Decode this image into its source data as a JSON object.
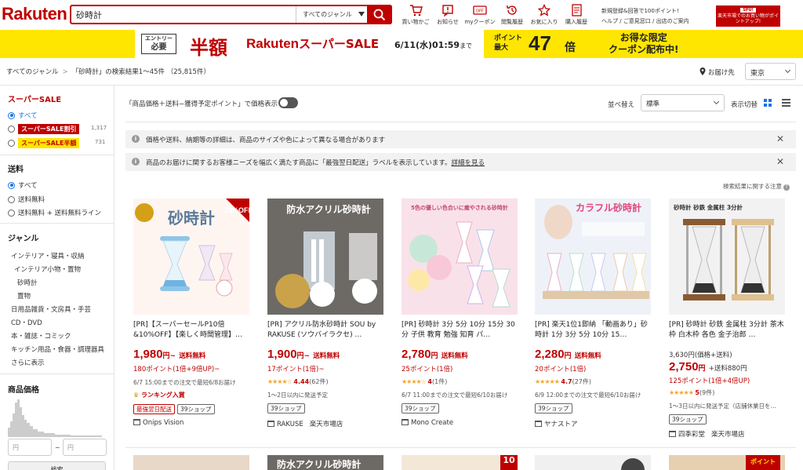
{
  "header": {
    "logo": "Rakuten",
    "search_value": "砂時計",
    "genre_select": "すべてのジャンル",
    "icons": [
      {
        "label": "買い物かご",
        "icon": "cart-icon"
      },
      {
        "label": "お知らせ",
        "icon": "notice-icon"
      },
      {
        "label": "myクーポン",
        "icon": "coupon-icon"
      },
      {
        "label": "閲覧履歴",
        "icon": "history-icon"
      },
      {
        "label": "お気に入り",
        "icon": "star-icon"
      },
      {
        "label": "購入履歴",
        "icon": "receipt-icon"
      }
    ],
    "promo": "新規登録&回答で100ポイント!",
    "help": "ヘルプ / ご意見窓口 / 出店のご案内",
    "spu_top": "SPU!",
    "spu_text": "楽天市場でのお買い物がポイントアップ!"
  },
  "banner": {
    "entry_top": "エントリー",
    "entry_bottom": "必要",
    "hangaku": "半額",
    "brand": "Rakuten",
    "sale": "スーパーSALE",
    "deadline": "6/11(水)01:59",
    "deadline_suffix": "まで",
    "point_label_1": "ポイント",
    "point_label_2": "最大",
    "point_num": "47",
    "point_unit": "倍",
    "coupon_1": "お得な限定",
    "coupon_2": "クーポン配布中!"
  },
  "breadcrumb": {
    "root": "すべてのジャンル",
    "sep": ">",
    "result": "「砂時計」の検索結果1〜45件 （25,815件）"
  },
  "delivery": {
    "label": "お届け先",
    "region": "東京"
  },
  "sidebar": {
    "super_sale_title": "スーパーSALE",
    "sale_all": "すべて",
    "sale_discount": "スーパーSALE割引",
    "sale_discount_count": "1,317",
    "sale_half": "スーパーSALE半額",
    "sale_half_count": "731",
    "shipping_title": "送料",
    "ship_all": "すべて",
    "ship_free": "送料無料",
    "ship_free_line": "送料無料 + 送料無料ライン",
    "genre_title": "ジャンル",
    "genres": [
      "インテリア・寝具・収納",
      "インテリア小物・置物",
      "砂時計",
      "置物",
      "日用品雑貨・文房具・手芸",
      "CD・DVD",
      "本・雑誌・コミック",
      "キッチン用品・食器・調理器具",
      "さらに表示"
    ],
    "price_title": "商品価格",
    "price_min_ph": "円",
    "price_tilde": "~",
    "price_max_ph": "円",
    "search_btn": "検索"
  },
  "toolbar": {
    "toggle_text": "「商品価格＋送料−獲得予定ポイント」で価格表示",
    "sort_label": "並べ替え",
    "sort_value": "標準",
    "view_label": "表示切替"
  },
  "notices": [
    "価格や送料、納期等の詳細は、商品のサイズや色によって異なる場合があります",
    "商品のお届けに関するお客様ニーズを幅広く満たす商品に「最強翌日配送」ラベルを表示しています。"
  ],
  "notice_link": "詳細を見る",
  "disclaimer": "検索結果に関する注意",
  "products": [
    {
      "title": "[PR]【スーパーセールP10倍&10%OFF】【楽しく時間管理】…",
      "price": "1,980",
      "price_suffix": "円~",
      "shipping": "送料無料",
      "point": "180ポイント(1倍+9倍UP)~",
      "delivery": "6/7 15:00までの注文で最短6/8お届け",
      "rank": "ランキング入賞",
      "badge_red": "最強翌日配送",
      "badge39": "39ショップ",
      "shop": "Onips Vision",
      "img_label": "砂時計",
      "img_corner": "10%OFF"
    },
    {
      "title": "[PR] アクリル防水砂時計 SOU by RAKUSE (ソウバイラクセ) …",
      "price": "1,900",
      "price_suffix": "円~",
      "shipping": "送料無料",
      "point": "17ポイント(1倍)~",
      "stars": "★★★★☆",
      "rating": "4.44",
      "reviews": "(62件)",
      "delivery": "1〜2日以内に発送予定",
      "badge39": "39ショップ",
      "shop": "RAKUSE",
      "mall": "楽天市場店",
      "img_label": "防水アクリル砂時計"
    },
    {
      "title": "[PR] 砂時計 3分 5分 10分 15分 30分 子供 教育 勉強 知育 パ…",
      "price": "2,780",
      "price_suffix": "円",
      "shipping": "送料無料",
      "point": "25ポイント(1倍)",
      "stars": "★★★★☆",
      "rating": "4",
      "reviews": "(1件)",
      "delivery": "6/7 11:00までの注文で最短6/10お届け",
      "badge39": "39ショップ",
      "shop": "Mono Create",
      "img_label": "5色の優しい色合いに癒やされる砂時計"
    },
    {
      "title": "[PR] 楽天1位1即納 「動画あり」砂時計 1分 3分 5分 10分 15…",
      "price": "2,280",
      "price_suffix": "円",
      "shipping": "送料無料",
      "point": "20ポイント(1倍)",
      "stars": "★★★★★",
      "rating": "4.7",
      "reviews": "(27件)",
      "delivery": "6/9 12:00までの注文で最短6/10お届け",
      "badge39": "39ショップ",
      "shop": "ヤナストア",
      "img_label": "カラフル砂時計"
    },
    {
      "title": "[PR] 砂時計 砂鉄 金属柱 3分計 茶木枠 白木枠 各色 金子治郎 …",
      "base_price": "3,630円(価格+送料)",
      "price": "2,750",
      "price_suffix": "円",
      "extra": "+送料880円",
      "point": "125ポイント(1倍+4倍UP)",
      "stars": "★★★★★",
      "rating": "5",
      "reviews": "(9件)",
      "delivery": "1〜3日以内に発送予定（店舗休業日を…",
      "badge39": "39ショップ",
      "shop": "四季彩堂",
      "mall": "楽天市場店",
      "img_label": "砂時計 砂鉄 金属柱 3分計"
    }
  ],
  "row2": {
    "img_label_2": "防水アクリル砂時計",
    "img_corner_4": "10",
    "img_corner_6": "ポイント"
  },
  "colors": {
    "brand_red": "#bf0000",
    "banner_yellow": "#ffe600",
    "link_blue": "#1a73e8"
  }
}
